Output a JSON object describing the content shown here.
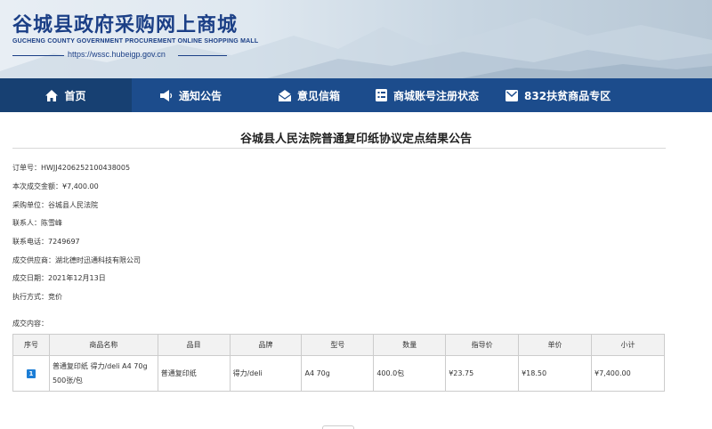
{
  "header": {
    "title": "谷城县政府采购网上商城",
    "subtitle_en": "GUCHENG COUNTY GOVERNMENT PROCUREMENT ONLINE SHOPPING MALL",
    "url": "https://wssc.hubeigp.gov.cn"
  },
  "nav": {
    "home": "首页",
    "notice": "通知公告",
    "feedback": "意见信箱",
    "account_status": "商城账号注册状态",
    "poverty_zone": "832扶贫商品专区"
  },
  "page": {
    "title": "谷城县人民法院普通复印纸协议定点结果公告"
  },
  "info": {
    "order_no": "订单号：HWJJ4206252100438005",
    "amount": "本次成交金额：¥7,400.00",
    "purchaser": "采购单位：谷城县人民法院",
    "contact": "联系人：陈雪峰",
    "phone": "联系电话：7249697",
    "supplier": "成交供应商：湖北德时迅通科技有限公司",
    "date": "成交日期：2021年12月13日",
    "method": "执行方式：竞价",
    "content_label": "成交内容："
  },
  "table": {
    "headers": [
      "序号",
      "商品名称",
      "品目",
      "品牌",
      "型号",
      "数量",
      "指导价",
      "单价",
      "小计"
    ],
    "rows": [
      {
        "index": "1",
        "name": "普通复印纸 得力/deli A4 70g 500张/包",
        "category": "普通复印纸",
        "brand": "得力/deli",
        "model": "A4 70g",
        "quantity": "400.0包",
        "guide_price": "¥23.75",
        "unit_price": "¥18.50",
        "subtotal": "¥7,400.00"
      }
    ]
  },
  "colors": {
    "nav_bg": "#1c4c8c",
    "title_blue": "#1b3f86",
    "price_red": "#e00000"
  }
}
